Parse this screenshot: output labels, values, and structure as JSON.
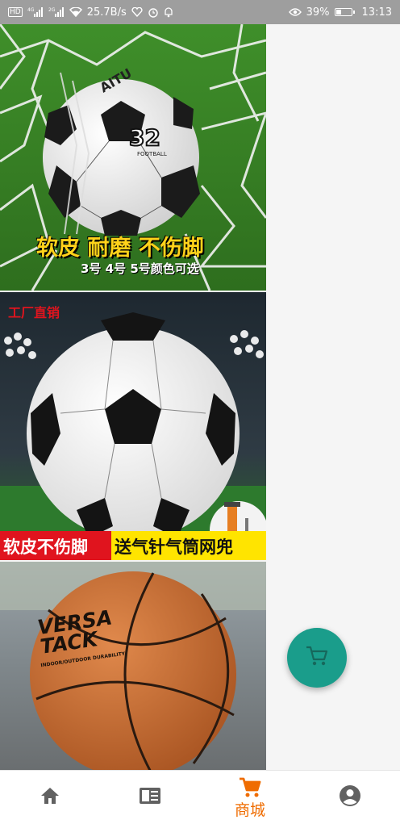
{
  "status_bar": {
    "network_left": "HD",
    "sig1": "4G",
    "sig2": "2G",
    "speed": "25.7B/s",
    "battery_percent": "39%",
    "battery_level": 0.39,
    "time": "13:13"
  },
  "products": [
    {
      "headline": "软皮 耐磨 不伤脚",
      "subline": "3号 4号 5号颜色可选",
      "ball_brand": "AITU",
      "ball_number": "32",
      "ball_word": "FOOTBALL"
    },
    {
      "tag": "工厂直销",
      "banner_left": "软皮不伤脚",
      "banner_right": "送气针气筒网兜"
    },
    {
      "ball_brand": "VERSA TACK",
      "ball_sub": "INDOOR/OUTDOOR DURABILITY"
    }
  ],
  "colors": {
    "accent": "#ef6c00",
    "fab": "#1a9d8b",
    "nav_icon": "#616161"
  },
  "bottom_nav": {
    "items": [
      {
        "icon": "home-icon",
        "label": ""
      },
      {
        "icon": "news-icon",
        "label": ""
      },
      {
        "icon": "cart-icon",
        "label": "商城"
      },
      {
        "icon": "account-icon",
        "label": ""
      }
    ],
    "selected": 2
  },
  "fab": {
    "icon": "cart-icon"
  }
}
